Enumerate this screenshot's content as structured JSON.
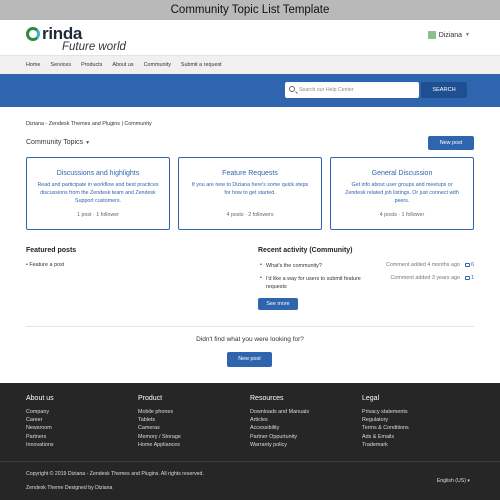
{
  "template_title": "Community Topic List Template",
  "header": {
    "logo_brand": "rinda",
    "logo_sub": "Future world",
    "user_name": "Diziana"
  },
  "nav": [
    "Home",
    "Services",
    "Products",
    "About us",
    "Community",
    "Submit a request"
  ],
  "search": {
    "placeholder": "Search our Help Center",
    "button_label": "SEARCH"
  },
  "breadcrumb": "Diziana - Zendesk Themes and Plugins  |  Community",
  "topics_heading": "Community Topics",
  "new_post_label": "New post",
  "cards": [
    {
      "title": "Discussions and highlights",
      "desc": "Read and participate in workflow and best practices discussions from the Zendesk team and Zendesk Support customers.",
      "meta": "1 post  ·  1 follower"
    },
    {
      "title": "Feature Requests",
      "desc": "If you are new to Diziana here's some quick steps for how to get started.",
      "meta": "4 posts  ·  2 followers"
    },
    {
      "title": "General Discussion",
      "desc": "Get info about user groups and meetups or Zendesk related job listings. Or just connect with peers.",
      "meta": "4 posts  ·  1 follower"
    }
  ],
  "featured": {
    "title": "Featured posts",
    "items": [
      "Feature a post"
    ]
  },
  "recent": {
    "title": "Recent activity (Community)",
    "items": [
      {
        "question": "What's the community?",
        "meta": "Comment added 4 months ago",
        "count": "6"
      },
      {
        "question": "I'd like a way for users to submit feature requests",
        "meta": "Comment added 3 years ago",
        "count": "1"
      }
    ],
    "see_more": "See more"
  },
  "cta": {
    "text": "Didn't find what you were looking for?",
    "button": "New post"
  },
  "footer": {
    "columns": [
      {
        "heading": "About us",
        "links": [
          "Company",
          "Career",
          "Newsroom",
          "Partners",
          "Innovations"
        ]
      },
      {
        "heading": "Product",
        "links": [
          "Mobile phones",
          "Tablets",
          "Cameras",
          "Memory / Storage",
          "Home Appliances"
        ]
      },
      {
        "heading": "Resources",
        "links": [
          "Downloads and Manuals",
          "Articles",
          "Accessibility",
          "Partner Oppurtunity",
          "Warranty policy"
        ]
      },
      {
        "heading": "Legal",
        "links": [
          "Privacy statements",
          "Regulatory",
          "Terms & Conditions",
          "Ads & Emails",
          "Trademark"
        ]
      }
    ],
    "copyright": "Copyright © 2019 Diziana - Zendesk Themes and Plugins. All rights reserved.",
    "designed_by": "Zendesk Theme Designed by Diziana",
    "language": "English (US)"
  },
  "colors": {
    "primary": "#2f64ae",
    "hero": "#2f64ae",
    "footer_bg": "#262626"
  }
}
